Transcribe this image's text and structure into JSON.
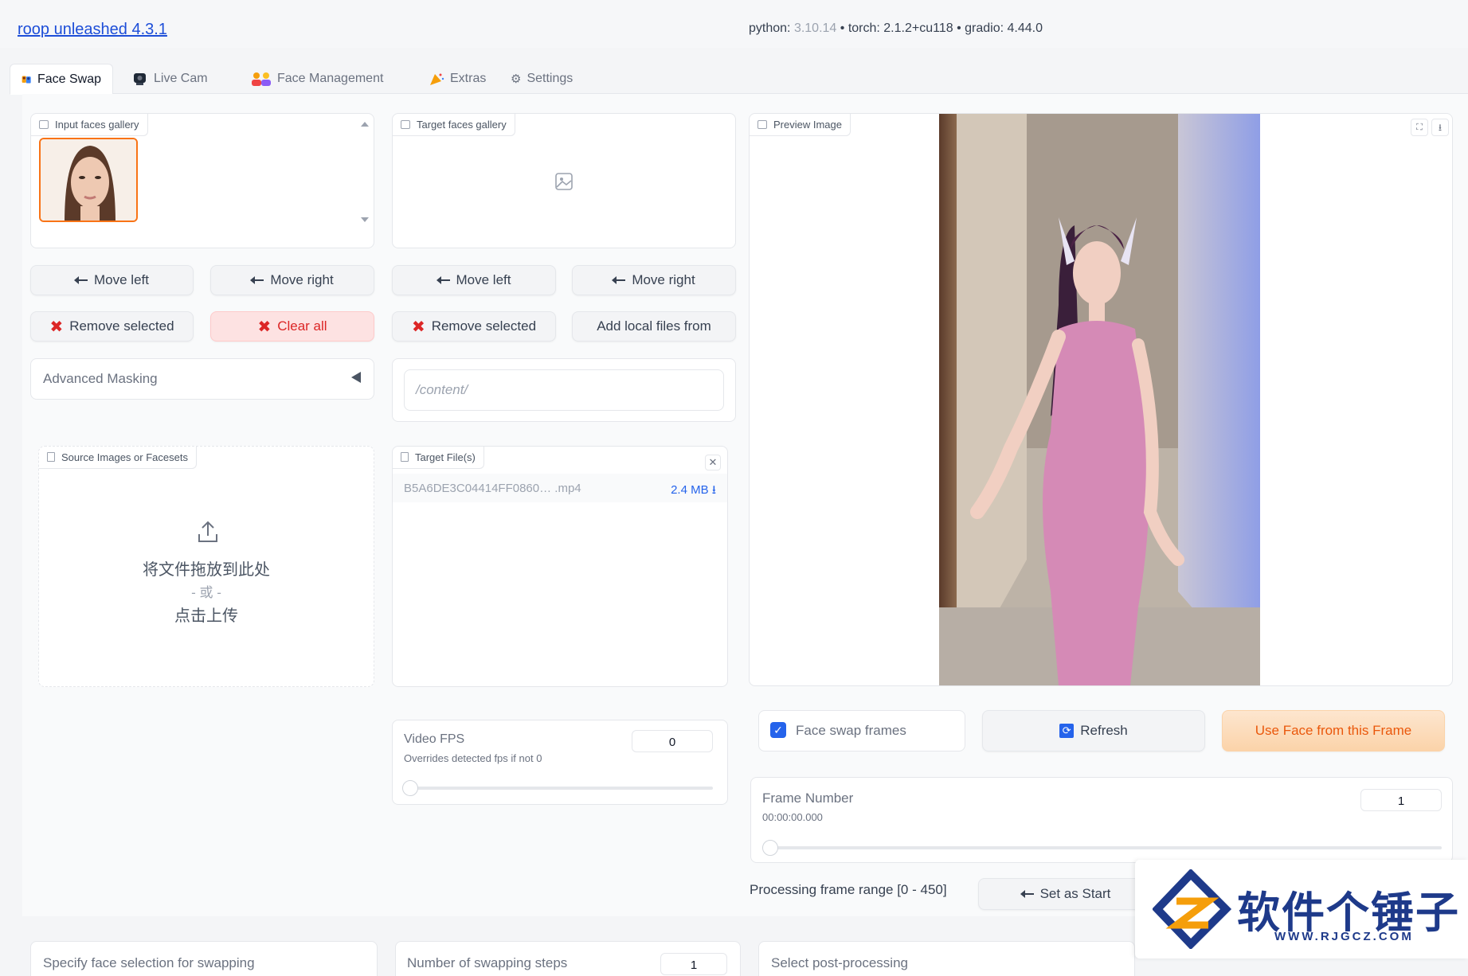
{
  "header": {
    "title": "roop unleashed 4.3.1",
    "versions_prefix": "python: ",
    "python_version": "3.10.14",
    "versions_rest": " • torch: 2.1.2+cu118 • gradio: 4.44.0"
  },
  "tabs": [
    {
      "label": "Face Swap"
    },
    {
      "label": "Live Cam"
    },
    {
      "label": "Face Management"
    },
    {
      "label": "Extras"
    },
    {
      "label": "Settings"
    }
  ],
  "input_gallery": {
    "label": "Input faces gallery",
    "move_left": "Move left",
    "move_right": "Move right",
    "remove_selected": "Remove selected",
    "clear_all": "Clear all"
  },
  "target_gallery": {
    "label": "Target faces gallery",
    "move_left": "Move left",
    "move_right": "Move right",
    "remove_selected": "Remove selected",
    "add_local": "Add local files from"
  },
  "advanced_masking": {
    "label": "Advanced Masking"
  },
  "local_path": {
    "value": "/content/"
  },
  "source_upload": {
    "label": "Source Images or Facesets",
    "drop_text": "将文件拖放到此处",
    "or_text": "- 或 -",
    "click_text": "点击上传"
  },
  "target_files": {
    "label": "Target File(s)",
    "file_name": "B5A6DE3C04414FF0860… .mp4",
    "file_size": "2.4 MB ⭳"
  },
  "video_fps": {
    "label": "Video FPS",
    "info": "Overrides detected fps if not 0",
    "value": "0"
  },
  "preview": {
    "label": "Preview Image"
  },
  "controls": {
    "face_swap_frames": "Face swap frames",
    "face_swap_frames_checked": true,
    "refresh": "Refresh",
    "use_face": "Use Face from this Frame"
  },
  "frame_number": {
    "label": "Frame Number",
    "time": "00:00:00.000",
    "value": "1"
  },
  "processing": {
    "range_text": "Processing frame range [0 - 450]",
    "set_as_start": "Set as Start"
  },
  "bottom": {
    "face_selection": "Specify face selection for swapping",
    "swap_steps_label": "Number of swapping steps",
    "swap_steps_value": "1",
    "post_processing": "Select post-processing"
  },
  "watermark": {
    "brand": "软件个锤子",
    "url": "WWW.RJGCZ.COM"
  },
  "colors": {
    "accent_link": "#1d4ed8",
    "danger": "#dc2626",
    "primary_orange": "#ea580c",
    "checkbox_blue": "#2563eb"
  }
}
